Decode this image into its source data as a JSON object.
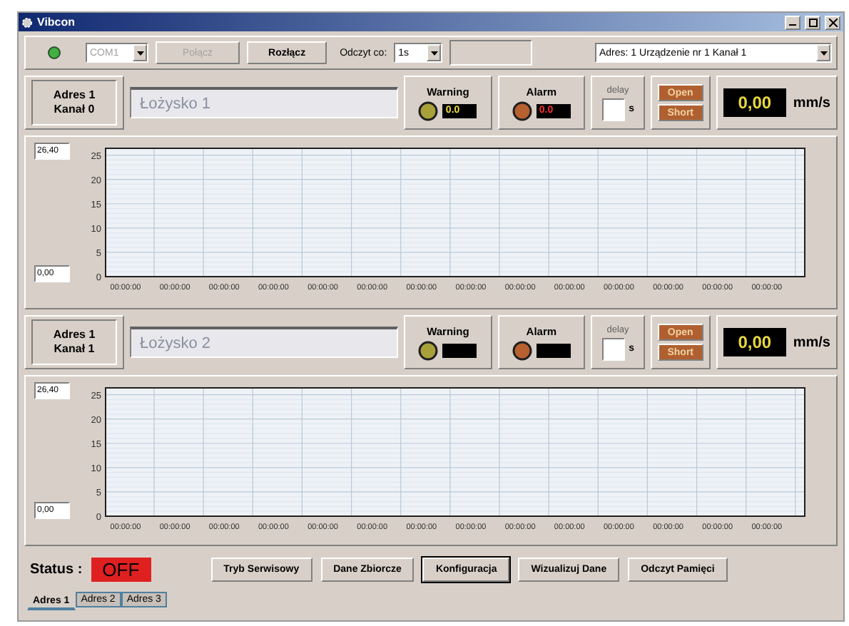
{
  "window": {
    "title": "Vibcon"
  },
  "toolbar": {
    "connection_led": {
      "on": true
    },
    "port": {
      "value": "COM1",
      "disabled": true
    },
    "connect_button": {
      "label": "Połącz",
      "disabled": true
    },
    "disconnect_button": {
      "label": "Rozłącz",
      "disabled": false
    },
    "read_every": {
      "label": "Odczyt co:",
      "value": "1s"
    },
    "device_select": {
      "value": "Adres: 1 Urządzenie nr 1  Kanał 1"
    }
  },
  "channels": [
    {
      "address": "Adres 1",
      "channel": "Kanał 0",
      "name": "Łożysko 1",
      "indicators": [
        {
          "kind": "warning",
          "label": "Warning",
          "reading": "0.0"
        },
        {
          "kind": "alarm",
          "label": "Alarm",
          "reading": "0.0"
        }
      ],
      "delay": {
        "label": "delay",
        "unit": "s"
      },
      "open_button": "Open",
      "short_button": "Short",
      "value": "0,00",
      "unit": "mm/s",
      "chart_max": "26,40",
      "chart_min": "0,00",
      "chart_data": {
        "type": "line",
        "grid": true,
        "ylim": [
          0,
          26.4
        ],
        "yticks": [
          0,
          5,
          10,
          15,
          20,
          25
        ],
        "categories": [
          "00:00:00",
          "00:00:00",
          "00:00:00",
          "00:00:00",
          "00:00:00",
          "00:00:00",
          "00:00:00",
          "00:00:00",
          "00:00:00",
          "00:00:00",
          "00:00:00",
          "00:00:00",
          "00:00:00",
          "00:00:00"
        ]
      }
    },
    {
      "address": "Adres 1",
      "channel": "Kanał 1",
      "name": "Łożysko 2",
      "indicators": [
        {
          "kind": "warning",
          "label": "Warning"
        },
        {
          "kind": "alarm",
          "label": "Alarm"
        }
      ],
      "delay": {
        "label": "delay",
        "unit": "s"
      },
      "open_button": "Open",
      "short_button": "Short",
      "value": "0,00",
      "unit": "mm/s",
      "chart_max": "26,40",
      "chart_min": "0,00",
      "chart_data": {
        "type": "line",
        "grid": true,
        "ylim": [
          0,
          26.4
        ],
        "yticks": [
          0,
          5,
          10,
          15,
          20,
          25
        ],
        "categories": [
          "00:00:00",
          "00:00:00",
          "00:00:00",
          "00:00:00",
          "00:00:00",
          "00:00:00",
          "00:00:00",
          "00:00:00",
          "00:00:00",
          "00:00:00",
          "00:00:00",
          "00:00:00",
          "00:00:00",
          "00:00:00"
        ]
      }
    }
  ],
  "status": {
    "label": "Status :",
    "value": "OFF"
  },
  "buttons": [
    {
      "label": "Tryb Serwisowy",
      "focused": false
    },
    {
      "label": "Dane Zbiorcze",
      "focused": false
    },
    {
      "label": "Konfiguracja",
      "focused": true
    },
    {
      "label": "Wizualizuj Dane",
      "focused": false
    },
    {
      "label": "Odczyt Pamięci",
      "focused": false
    }
  ],
  "tabs": [
    {
      "label": "Adres 1",
      "selected": true
    },
    {
      "label": "Adres 2",
      "selected": false
    },
    {
      "label": "Adres 3",
      "selected": false
    }
  ]
}
